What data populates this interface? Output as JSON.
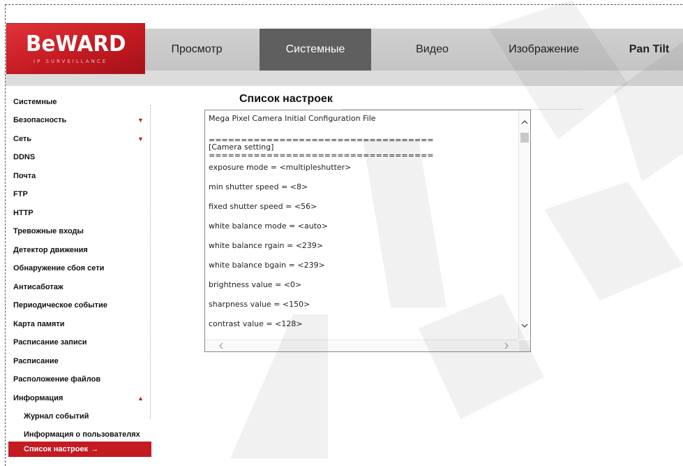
{
  "logo": {
    "main": "BeWARD",
    "sub": "IP SURVEILLANCE"
  },
  "nav": {
    "tabs": [
      {
        "label": "Просмотр"
      },
      {
        "label": "Системные"
      },
      {
        "label": "Видео"
      },
      {
        "label": "Изображение"
      },
      {
        "label": "Pan Tilt"
      }
    ],
    "active": "Системные"
  },
  "sidebar": {
    "items": [
      {
        "label": "Системные"
      },
      {
        "label": "Безопасность",
        "arrow": "▼"
      },
      {
        "label": "Сеть",
        "arrow": "▼"
      },
      {
        "label": "DDNS"
      },
      {
        "label": "Почта"
      },
      {
        "label": "FTP"
      },
      {
        "label": "HTTP"
      },
      {
        "label": "Тревожные входы"
      },
      {
        "label": "Детектор движения"
      },
      {
        "label": "Обнаружение сбоя сети"
      },
      {
        "label": "Антисаботаж"
      },
      {
        "label": "Периодическое событие"
      },
      {
        "label": "Карта памяти"
      },
      {
        "label": "Расписание записи"
      },
      {
        "label": "Расписание"
      },
      {
        "label": "Расположение файлов"
      },
      {
        "label": "Информация",
        "arrow": "▲"
      },
      {
        "label": "Журнал событий"
      },
      {
        "label": "Информация о пользователях"
      },
      {
        "label": "Список настроек",
        "arrow": "→"
      }
    ]
  },
  "content": {
    "title": "Список настроек",
    "lines": [
      "Mega Pixel Camera Initial Configuration File",
      "===================================",
      "[Camera setting]",
      "===================================",
      "exposure mode = <multipleshutter>",
      "min shutter speed = <8>",
      "fixed shutter speed = <56>",
      "white balance mode = <auto>",
      "white balance rgain = <239>",
      "white balance bgain = <239>",
      "brightness value = <0>",
      "sharpness value = <150>",
      "contrast value = <128>"
    ]
  },
  "watermark": {
    "text": "BEWARD",
    "color": "#f0f0f0"
  },
  "colors": {
    "accent": "#c41a22",
    "tab_active": "#5f5f5f",
    "header": "#c8c8c8"
  }
}
